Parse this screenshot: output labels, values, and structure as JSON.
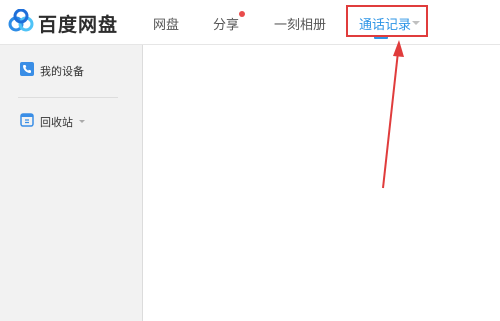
{
  "app": {
    "brand": "百度网盘"
  },
  "nav": {
    "items": [
      {
        "label": "网盘"
      },
      {
        "label": "分享"
      },
      {
        "label": "一刻相册"
      },
      {
        "label": "通话记录"
      }
    ],
    "notification_dot_color": "#e94b4b"
  },
  "sidebar": {
    "items": [
      {
        "label": "我的设备",
        "icon": "phone-icon"
      },
      {
        "label": "回收站",
        "icon": "recycle-bin-icon"
      }
    ]
  },
  "annotation": {
    "color": "#e03c3c"
  },
  "colors": {
    "accent": "#2e95e6"
  }
}
